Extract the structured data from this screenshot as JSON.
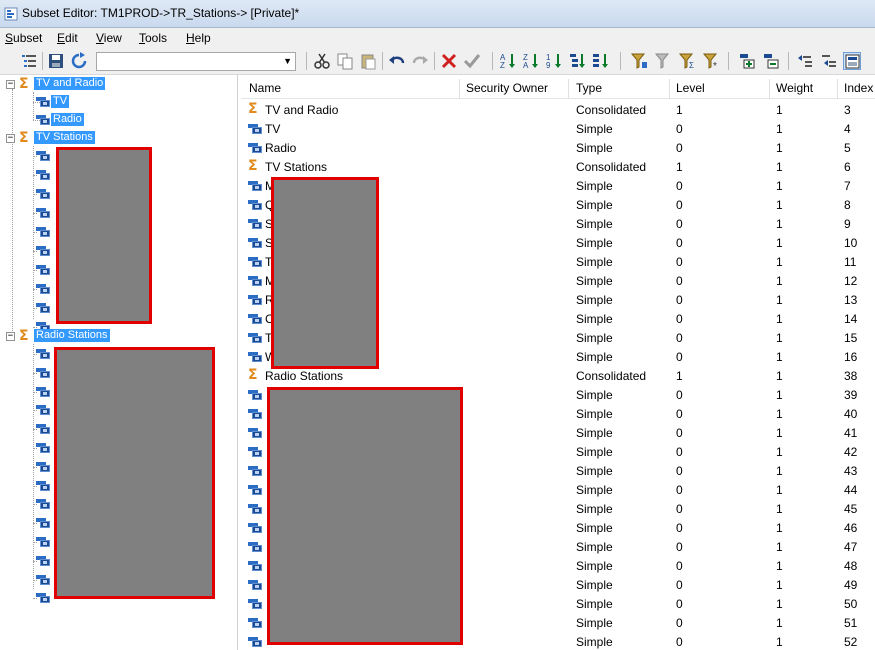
{
  "window": {
    "title": "Subset Editor:  TM1PROD->TR_Stations->  [Private]*"
  },
  "menu": {
    "items": [
      {
        "label": "Subset",
        "accel": "S",
        "rest": "ubset"
      },
      {
        "label": "Edit",
        "accel": "E",
        "rest": "dit"
      },
      {
        "label": "View",
        "accel": "V",
        "rest": "iew"
      },
      {
        "label": "Tools",
        "accel": "T",
        "rest": "ools"
      },
      {
        "label": "Help",
        "accel": "H",
        "rest": "elp"
      }
    ]
  },
  "toolbar": {
    "subset_combo_value": "",
    "icons": [
      "all-icon",
      "save-icon",
      "refresh-icon",
      "cut-icon",
      "copy-icon",
      "paste-icon",
      "undo-icon",
      "redo-icon",
      "delete-icon",
      "keep-icon",
      "sort-asc-icon",
      "sort-desc-icon",
      "sort-index-asc-icon",
      "sort-hierarchy-icon",
      "sort-index-desc-icon",
      "filter-attribute-icon",
      "filter-level-icon",
      "filter-expression-icon",
      "filter-wildcard-icon",
      "expand-icon",
      "collapse-icon",
      "insert-parent-icon",
      "insert-child-icon",
      "properties-icon"
    ]
  },
  "tree": {
    "nodes": [
      {
        "label": "TV and Radio",
        "type": "consolidated",
        "expander": "−"
      },
      {
        "label": "TV",
        "type": "simple"
      },
      {
        "label": "Radio",
        "type": "simple"
      },
      {
        "label": "TV Stations",
        "type": "consolidated",
        "expander": "−"
      },
      {
        "label": "Radio Stations",
        "type": "consolidated",
        "expander": "−"
      }
    ]
  },
  "grid": {
    "columns": [
      "Name",
      "Security Owner",
      "Type",
      "Level",
      "Weight",
      "Index"
    ],
    "rows": [
      {
        "name": "TV and Radio",
        "type": "Consolidated",
        "level": "1",
        "weight": "1",
        "index": "3",
        "icon": "sigma-icon"
      },
      {
        "name": "TV",
        "type": "Simple",
        "level": "0",
        "weight": "1",
        "index": "4",
        "icon": "element-icon"
      },
      {
        "name": "Radio",
        "type": "Simple",
        "level": "0",
        "weight": "1",
        "index": "5",
        "icon": "element-icon"
      },
      {
        "name": "TV Stations",
        "type": "Consolidated",
        "level": "1",
        "weight": "1",
        "index": "6",
        "icon": "sigma-icon"
      },
      {
        "name": "M",
        "type": "Simple",
        "level": "0",
        "weight": "1",
        "index": "7",
        "icon": "element-icon"
      },
      {
        "name": "Q",
        "type": "Simple",
        "level": "0",
        "weight": "1",
        "index": "8",
        "icon": "element-icon"
      },
      {
        "name": "S",
        "type": "Simple",
        "level": "0",
        "weight": "1",
        "index": "9",
        "icon": "element-icon"
      },
      {
        "name": "S",
        "type": "Simple",
        "level": "0",
        "weight": "1",
        "index": "10",
        "icon": "element-icon"
      },
      {
        "name": "T",
        "type": "Simple",
        "level": "0",
        "weight": "1",
        "index": "11",
        "icon": "element-icon"
      },
      {
        "name": "M",
        "type": "Simple",
        "level": "0",
        "weight": "1",
        "index": "12",
        "icon": "element-icon"
      },
      {
        "name": "R",
        "type": "Simple",
        "level": "0",
        "weight": "1",
        "index": "13",
        "icon": "element-icon"
      },
      {
        "name": "C",
        "type": "Simple",
        "level": "0",
        "weight": "1",
        "index": "14",
        "icon": "element-icon"
      },
      {
        "name": "T",
        "type": "Simple",
        "level": "0",
        "weight": "1",
        "index": "15",
        "icon": "element-icon"
      },
      {
        "name": "W",
        "type": "Simple",
        "level": "0",
        "weight": "1",
        "index": "16",
        "icon": "element-icon"
      },
      {
        "name": "Radio Stations",
        "type": "Consolidated",
        "level": "1",
        "weight": "1",
        "index": "38",
        "icon": "sigma-icon"
      },
      {
        "name": "",
        "type": "Simple",
        "level": "0",
        "weight": "1",
        "index": "39",
        "icon": "element-icon"
      },
      {
        "name": "",
        "type": "Simple",
        "level": "0",
        "weight": "1",
        "index": "40",
        "icon": "element-icon"
      },
      {
        "name": "",
        "type": "Simple",
        "level": "0",
        "weight": "1",
        "index": "41",
        "icon": "element-icon"
      },
      {
        "name": "",
        "type": "Simple",
        "level": "0",
        "weight": "1",
        "index": "42",
        "icon": "element-icon"
      },
      {
        "name": "",
        "type": "Simple",
        "level": "0",
        "weight": "1",
        "index": "43",
        "icon": "element-icon"
      },
      {
        "name": "",
        "type": "Simple",
        "level": "0",
        "weight": "1",
        "index": "44",
        "icon": "element-icon"
      },
      {
        "name": "",
        "type": "Simple",
        "level": "0",
        "weight": "1",
        "index": "45",
        "icon": "element-icon"
      },
      {
        "name": "",
        "type": "Simple",
        "level": "0",
        "weight": "1",
        "index": "46",
        "icon": "element-icon"
      },
      {
        "name": "",
        "type": "Simple",
        "level": "0",
        "weight": "1",
        "index": "47",
        "icon": "element-icon"
      },
      {
        "name": "",
        "type": "Simple",
        "level": "0",
        "weight": "1",
        "index": "48",
        "icon": "element-icon"
      },
      {
        "name": "",
        "type": "Simple",
        "level": "0",
        "weight": "1",
        "index": "49",
        "icon": "element-icon"
      },
      {
        "name": "",
        "type": "Simple",
        "level": "0",
        "weight": "1",
        "index": "50",
        "icon": "element-icon"
      },
      {
        "name": "",
        "type": "Simple",
        "level": "0",
        "weight": "1",
        "index": "51",
        "icon": "element-icon"
      },
      {
        "name": "",
        "type": "Simple",
        "level": "0",
        "weight": "1",
        "index": "52",
        "icon": "element-icon"
      }
    ]
  },
  "colors": {
    "selection": "#3399ff",
    "redaction_fill": "#808080",
    "redaction_border": "#e00000",
    "sigma": "#e08a1c"
  }
}
